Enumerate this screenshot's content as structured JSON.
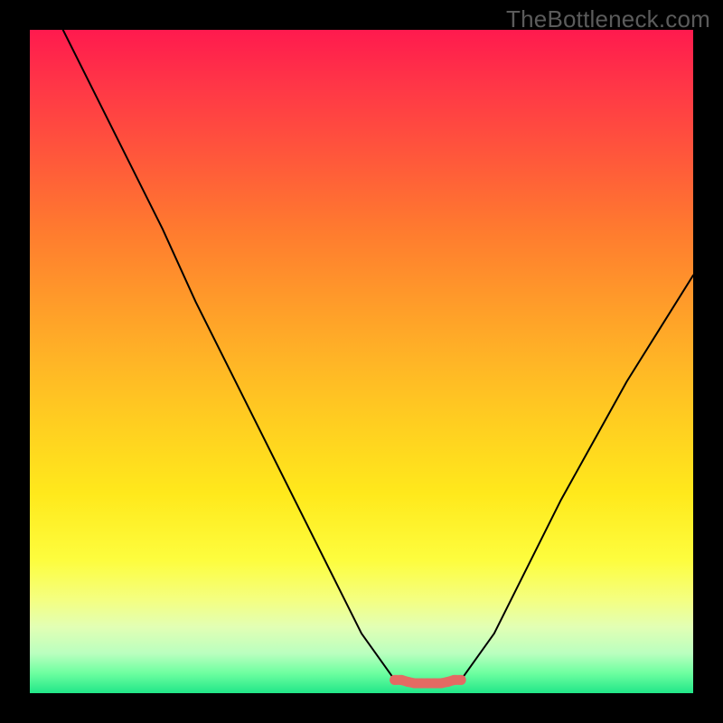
{
  "watermark": "TheBottleneck.com",
  "colors": {
    "frame": "#000000",
    "curve": "#000000",
    "marker": "#e46a63",
    "gradient_stops": [
      "#ff1a4e",
      "#ff3547",
      "#ff5a3a",
      "#ff7a2f",
      "#ff982a",
      "#ffb526",
      "#ffd020",
      "#ffe91c",
      "#fdfd3e",
      "#f4ff82",
      "#e2ffb4",
      "#baffbf",
      "#6dffa0",
      "#21e688"
    ]
  },
  "chart_data": {
    "type": "line",
    "title": "",
    "xlabel": "",
    "ylabel": "",
    "xlim": [
      0,
      100
    ],
    "ylim": [
      0,
      100
    ],
    "grid": false,
    "legend": false,
    "series": [
      {
        "name": "left-curve",
        "x": [
          5,
          10,
          15,
          20,
          25,
          30,
          35,
          40,
          45,
          50,
          55,
          56
        ],
        "values": [
          100,
          90,
          80,
          70,
          59,
          49,
          39,
          29,
          19,
          9,
          2,
          2
        ]
      },
      {
        "name": "flat-bottom",
        "x": [
          55,
          56,
          58,
          60,
          62,
          64,
          65
        ],
        "values": [
          2,
          2,
          1.5,
          1.5,
          1.5,
          2,
          2
        ]
      },
      {
        "name": "right-curve",
        "x": [
          64,
          65,
          70,
          75,
          80,
          85,
          90,
          95,
          100
        ],
        "values": [
          2,
          2,
          9,
          19,
          29,
          38,
          47,
          55,
          63
        ]
      }
    ],
    "annotations": [
      {
        "name": "bottom-markers",
        "type": "scatter",
        "color": "#e46a63",
        "x": [
          55,
          56,
          57,
          58,
          59,
          60,
          61,
          62,
          63,
          64,
          65
        ],
        "values": [
          2,
          2,
          1.7,
          1.5,
          1.5,
          1.5,
          1.5,
          1.5,
          1.7,
          2,
          2
        ]
      }
    ]
  }
}
